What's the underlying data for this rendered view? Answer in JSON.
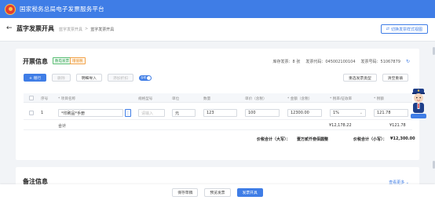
{
  "topbar": {
    "title": "国家税务总局电子发票服务平台"
  },
  "subheader": {
    "title": "蓝字发票开具",
    "breadcrumb": [
      "蓝字发票开具",
      ">",
      "蓝字发票开具"
    ],
    "switch_view": "切换发票样式视图"
  },
  "invoice": {
    "section_title": "开票信息",
    "tags": [
      "数电发票",
      "增值税"
    ],
    "stock_label": "库存发票：8 张",
    "code_label": "发票代码：045002100104",
    "number_label": "发票号码：51067879",
    "buttons_left": [
      "+ 增行",
      "删除",
      "明细导入",
      "添加折扣"
    ],
    "toggle_label": "含税",
    "buttons_right": [
      "重选发票类型",
      "清空重填"
    ],
    "columns": [
      "序号",
      "* 项目名称",
      "规格型号",
      "单位",
      "数量",
      "单价（含税）",
      "* 金额（含税）",
      "* 税率/征收率",
      "* 税额"
    ],
    "row": {
      "index": "1",
      "name": "*印刷品*手册",
      "spec_placeholder": "请输入",
      "unit": "元",
      "quantity": "123",
      "price": "100",
      "amount": "12300.00",
      "rate": "1%",
      "tax": "121.78"
    },
    "subtotal": {
      "label": "合计",
      "amount": "¥12,178.22",
      "tax": "¥121.78"
    },
    "total": {
      "caps_label": "价税合计（大写）：",
      "caps_value": "壹万贰仟叁佰圆整",
      "small_label": "价税合计（小写）：",
      "small_value": "¥12,300.00"
    }
  },
  "remark": {
    "title": "备注信息",
    "more": "查看更多 ⌄"
  },
  "bottom_buttons": [
    "保存草稿",
    "预览发票",
    "发票开具"
  ],
  "colors": {
    "primary": "#3f7de6",
    "brand_red": "#e33d2f",
    "green_tag": "#3aa55a",
    "orange_tag": "#e58a1f"
  }
}
